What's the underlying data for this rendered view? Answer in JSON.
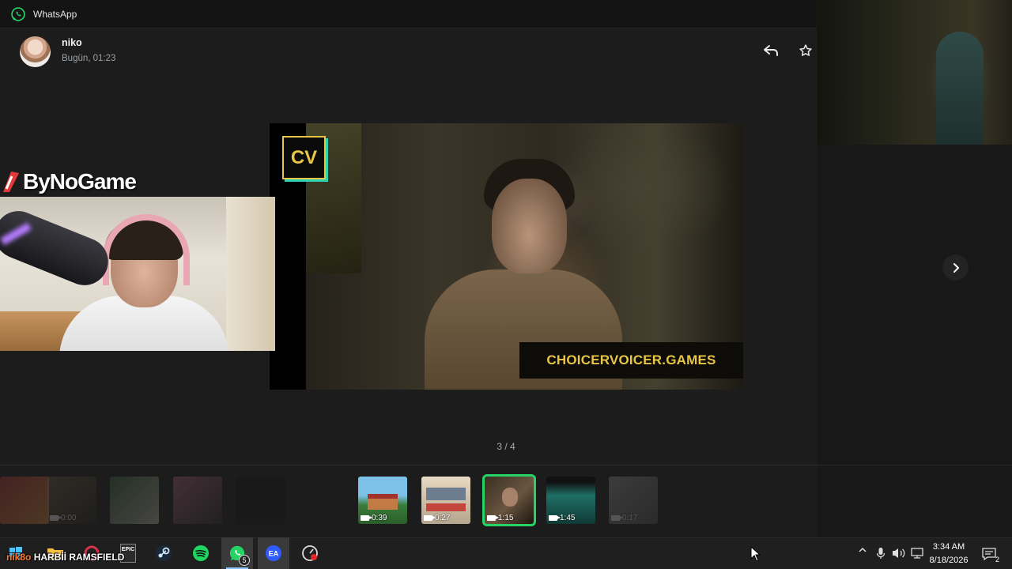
{
  "window": {
    "title": "WhatsApp"
  },
  "media_viewer": {
    "contact_name": "niko",
    "timestamp": "Bugün, 01:23",
    "video_watermark": "CHOICERVOICER.GAMES",
    "video_logo": "CV",
    "counter": "3 / 4",
    "icons": {
      "reply": "reply-icon",
      "star": "star-icon",
      "next": "chevron-right-icon"
    }
  },
  "thumbnails": [
    {
      "duration": "",
      "faded": true
    },
    {
      "duration": "0:00",
      "faded": true
    },
    {
      "duration": "",
      "faded": true
    },
    {
      "duration": "",
      "faded": true
    },
    {
      "duration": "",
      "faded": true
    },
    {
      "duration": "",
      "faded": true
    },
    {
      "duration": "0:39",
      "faded": false
    },
    {
      "duration": "0:27",
      "faded": false
    },
    {
      "duration": "1:15",
      "faded": false,
      "selected": true
    },
    {
      "duration": "1:45",
      "faded": false
    },
    {
      "duration": "0:17",
      "faded": true
    }
  ],
  "overlay": {
    "brand": "ByNoGame",
    "stream_nick": "nik8o",
    "stream_title": "HARBİİ RAMSFIELD"
  },
  "taskbar": {
    "whatsapp_badge": "5",
    "epic_label": "EPIC",
    "clock_time": "3:34 AM",
    "clock_date": "8/18/2026",
    "notifications": "2"
  },
  "colors": {
    "accent": "#25d366",
    "watermark": "#e8c547",
    "background": "#1c1c1c"
  }
}
